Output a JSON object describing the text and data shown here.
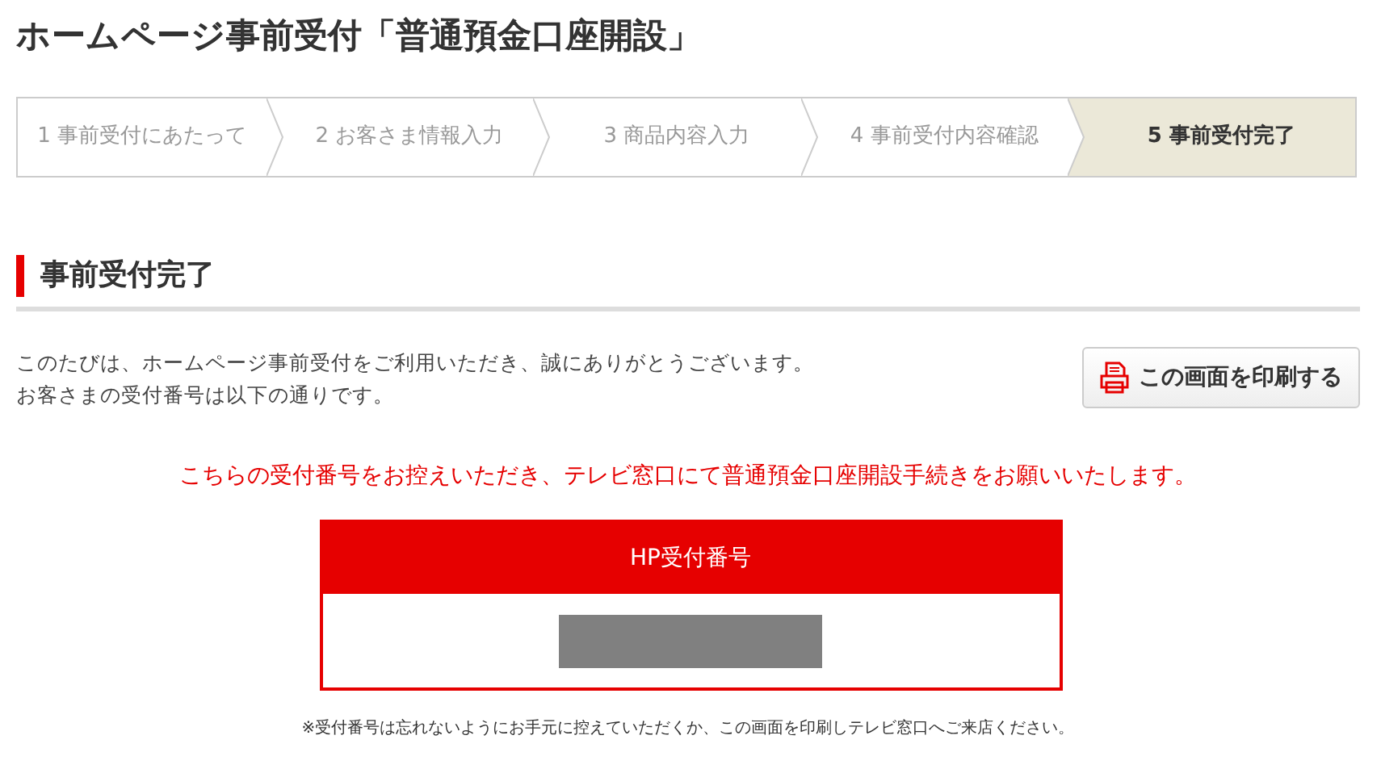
{
  "page_title": "ホームページ事前受付「普通預金口座開設」",
  "steps": [
    {
      "label": "1 事前受付にあたって",
      "selected": false
    },
    {
      "label": "2 お客さま情報入力",
      "selected": false
    },
    {
      "label": "3 商品内容入力",
      "selected": false
    },
    {
      "label": "4 事前受付内容確認",
      "selected": false
    },
    {
      "label": "5 事前受付完了",
      "selected": true
    }
  ],
  "section_heading": "事前受付完了",
  "intro_lines": [
    "このたびは、ホームページ事前受付をご利用いただき、誠にありがとうございます。",
    "お客さまの受付番号は以下の通りです。"
  ],
  "print_button": "この画面を印刷する",
  "notice": "こちらの受付番号をお控えいただき、テレビ窓口にて普通預金口座開設手続きをお願いいたします。",
  "receipt": {
    "heading": "HP受付番号",
    "kind": "redacted"
  },
  "footnote": "※受付番号は忘れないようにお手元に控えていただくか、この画面を印刷しテレビ窓口へご来店ください。"
}
